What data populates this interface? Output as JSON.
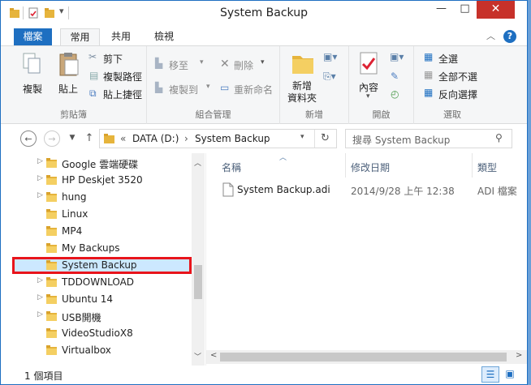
{
  "window": {
    "title": "System Backup"
  },
  "ribbon_tabs": [
    "檔案",
    "常用",
    "共用",
    "檢視"
  ],
  "clipboard": {
    "copy": "複製",
    "paste": "貼上",
    "cut": "剪下",
    "copy_path": "複製路徑",
    "paste_shortcut": "貼上捷徑",
    "group": "剪貼簿"
  },
  "organize": {
    "move_to": "移至",
    "copy_to": "複製到",
    "delete": "刪除",
    "rename": "重新命名",
    "group": "組合管理"
  },
  "new": {
    "new_folder_line1": "新增",
    "new_folder_line2": "資料夾",
    "group": "新增"
  },
  "open": {
    "properties": "內容",
    "group": "開啟"
  },
  "select": {
    "select_all": "全選",
    "select_none": "全部不選",
    "invert": "反向選擇",
    "group": "選取"
  },
  "address": {
    "prefix": "«",
    "drive": "DATA (D:)",
    "sep": "›",
    "folder": "System Backup"
  },
  "search": {
    "placeholder": "搜尋 System Backup"
  },
  "tree": [
    {
      "label": "Google 雲端硬碟",
      "expand": true,
      "selected": false
    },
    {
      "label": "HP Deskjet 3520",
      "expand": true,
      "selected": false
    },
    {
      "label": "hung",
      "expand": true,
      "selected": false
    },
    {
      "label": "Linux",
      "expand": false,
      "selected": false
    },
    {
      "label": "MP4",
      "expand": false,
      "selected": false
    },
    {
      "label": "My Backups",
      "expand": false,
      "selected": false
    },
    {
      "label": "System Backup",
      "expand": false,
      "selected": true
    },
    {
      "label": "TDDOWNLOAD",
      "expand": true,
      "selected": false
    },
    {
      "label": "Ubuntu 14",
      "expand": true,
      "selected": false
    },
    {
      "label": "USB開機",
      "expand": true,
      "selected": false
    },
    {
      "label": "VideoStudioX8",
      "expand": false,
      "selected": false
    },
    {
      "label": "Virtualbox",
      "expand": false,
      "selected": false
    }
  ],
  "columns": {
    "name": "名稱",
    "date": "修改日期",
    "type": "類型"
  },
  "files": [
    {
      "name": "System Backup.adi",
      "date": "2014/9/28 上午 12:38",
      "type": "ADI 檔案"
    }
  ],
  "status": {
    "count": "1 個項目"
  },
  "colors": {
    "accent": "#1e6fc1",
    "selected_bg": "#cce8ff",
    "highlight_border": "#e8141b",
    "folder": "#e6b43c"
  }
}
